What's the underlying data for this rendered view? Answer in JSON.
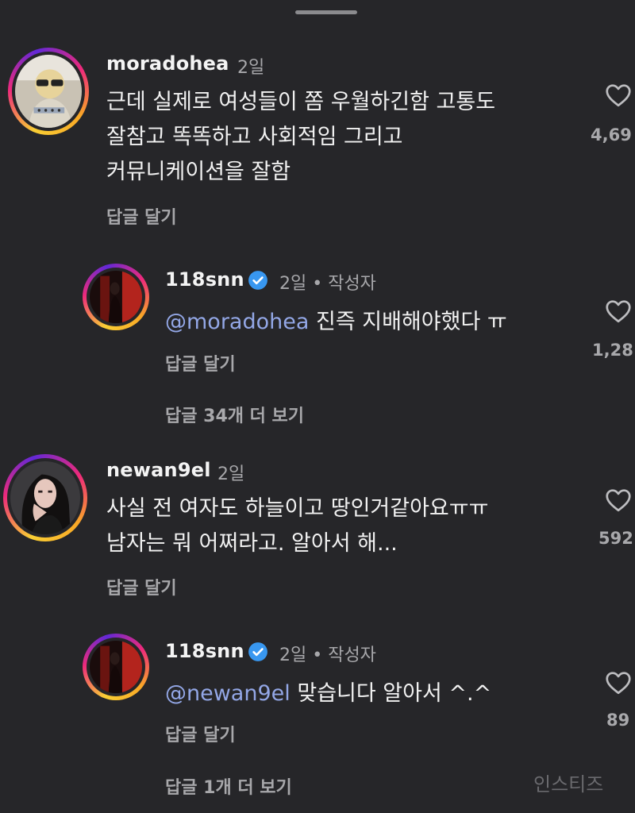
{
  "comments": [
    {
      "username": "moradohea",
      "time": "2일",
      "lines": [
        "근데 실제로 여성들이 쫌 우월하긴함 고통도",
        "잘참고 똑똑하고 사회적임 그리고",
        "커뮤니케이션을 잘함"
      ],
      "reply_label": "답글 달기",
      "like_count": "4,69",
      "avatar": "avatar-photo-costume"
    },
    {
      "username": "118snn",
      "verified": true,
      "time": "2일 • 작성자",
      "mention": "@moradohea",
      "text": " 진즉 지배해야했다 ㅠ",
      "reply_label": "답글 달기",
      "like_count": "1,28",
      "view_replies": "답글 34개 더 보기",
      "avatar": "avatar-photo-dark-red"
    },
    {
      "username": "newan9el",
      "time": "2일",
      "lines": [
        "사실 전 여자도 하늘이고 땅인거같아요ㅠㅠ",
        "남자는 뭐 어쩌라고. 알아서 해..."
      ],
      "reply_label": "답글 달기",
      "like_count": "592",
      "avatar": "avatar-photo-woman"
    },
    {
      "username": "118snn",
      "verified": true,
      "time": "2일 • 작성자",
      "mention": "@newan9el",
      "text": " 맞습니다 알아서 ^.^",
      "reply_label": "답글 달기",
      "like_count": "89",
      "view_replies": "답글 1개 더 보기",
      "avatar": "avatar-photo-dark-red"
    }
  ],
  "icons": {
    "like": "heart-outline-icon",
    "verified": "verified-badge-icon",
    "verified_color": "#3897f0"
  },
  "watermark": "인스티즈"
}
